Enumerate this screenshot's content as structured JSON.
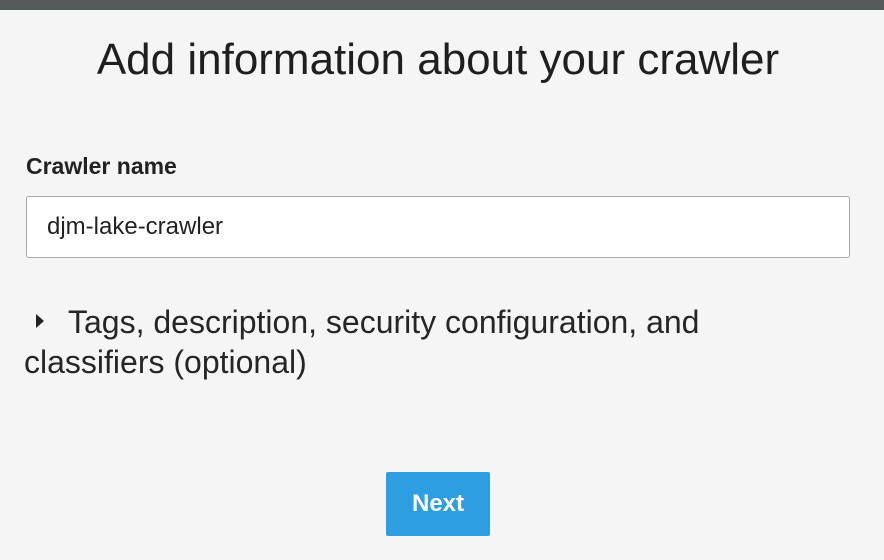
{
  "page": {
    "title": "Add information about your crawler"
  },
  "form": {
    "crawler_name_label": "Crawler name",
    "crawler_name_value": "djm-lake-crawler"
  },
  "optional_section": {
    "label": "Tags, description, security configuration, and classifiers (optional)",
    "expanded": false,
    "icon": "caret-right-icon"
  },
  "actions": {
    "next_label": "Next"
  },
  "colors": {
    "top_bar": "#545b5a",
    "background": "#f4f5f4",
    "primary_button": "#2d9ee0"
  }
}
